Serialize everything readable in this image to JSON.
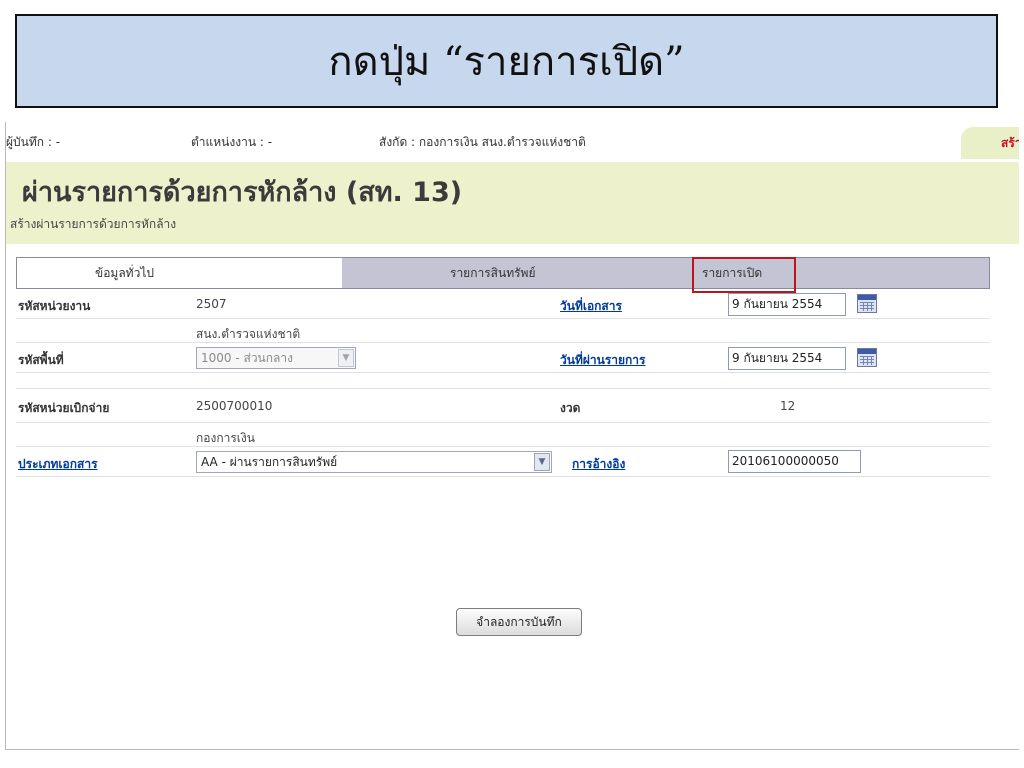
{
  "slide": {
    "title": "กดปุ่ม “รายการเปิด”"
  },
  "topbar": {
    "recorder": "ผู้บันทึก : -",
    "position": "ตำแหน่งงาน : -",
    "affiliation": "สังกัด : กองการเงิน สนง.ตำรวจแห่งชาติ",
    "create_label": "สร้าง"
  },
  "header": {
    "title": "ผ่านรายการด้วยการหักล้าง (สท. 13)",
    "subtitle": "สร้างผ่านรายการด้วยการหักล้าง"
  },
  "tabs": [
    {
      "label": "ข้อมูลทั่วไป",
      "active": true
    },
    {
      "label": "รายการสินทรัพย์",
      "active": false
    },
    {
      "label": "รายการเปิด",
      "active": false,
      "highlighted": true
    }
  ],
  "form": {
    "unit_code_label": "รหัสหน่วยงาน",
    "unit_code": "2507",
    "unit_name": "สนง.ตำรวจแห่งชาติ",
    "doc_date_label": "วันที่เอกสาร",
    "doc_date": "9 กันยายน 2554",
    "area_code_label": "รหัสพื้นที่",
    "area_code": "1000 - ส่วนกลาง",
    "posting_date_label": "วันที่ผ่านรายการ",
    "posting_date": "9 กันยายน 2554",
    "disburse_unit_label": "รหัสหน่วยเบิกจ่าย",
    "disburse_unit": "2500700010",
    "disburse_unit_name": "กองการเงิน",
    "period_label": "งวด",
    "period": "12",
    "doc_type_label": "ประเภทเอกสาร",
    "doc_type": "AA - ผ่านรายการสินทรัพย์",
    "reference_label": "การอ้างอิง",
    "reference": "20106100000050"
  },
  "actions": {
    "simulate_label": "จำลองการบันทึก"
  },
  "colors": {
    "banner": "#c6d7ee",
    "header_band": "#eef2cc",
    "tab_bg": "#c5c4d5",
    "highlight": "#c0141c",
    "link": "#003a9b"
  }
}
